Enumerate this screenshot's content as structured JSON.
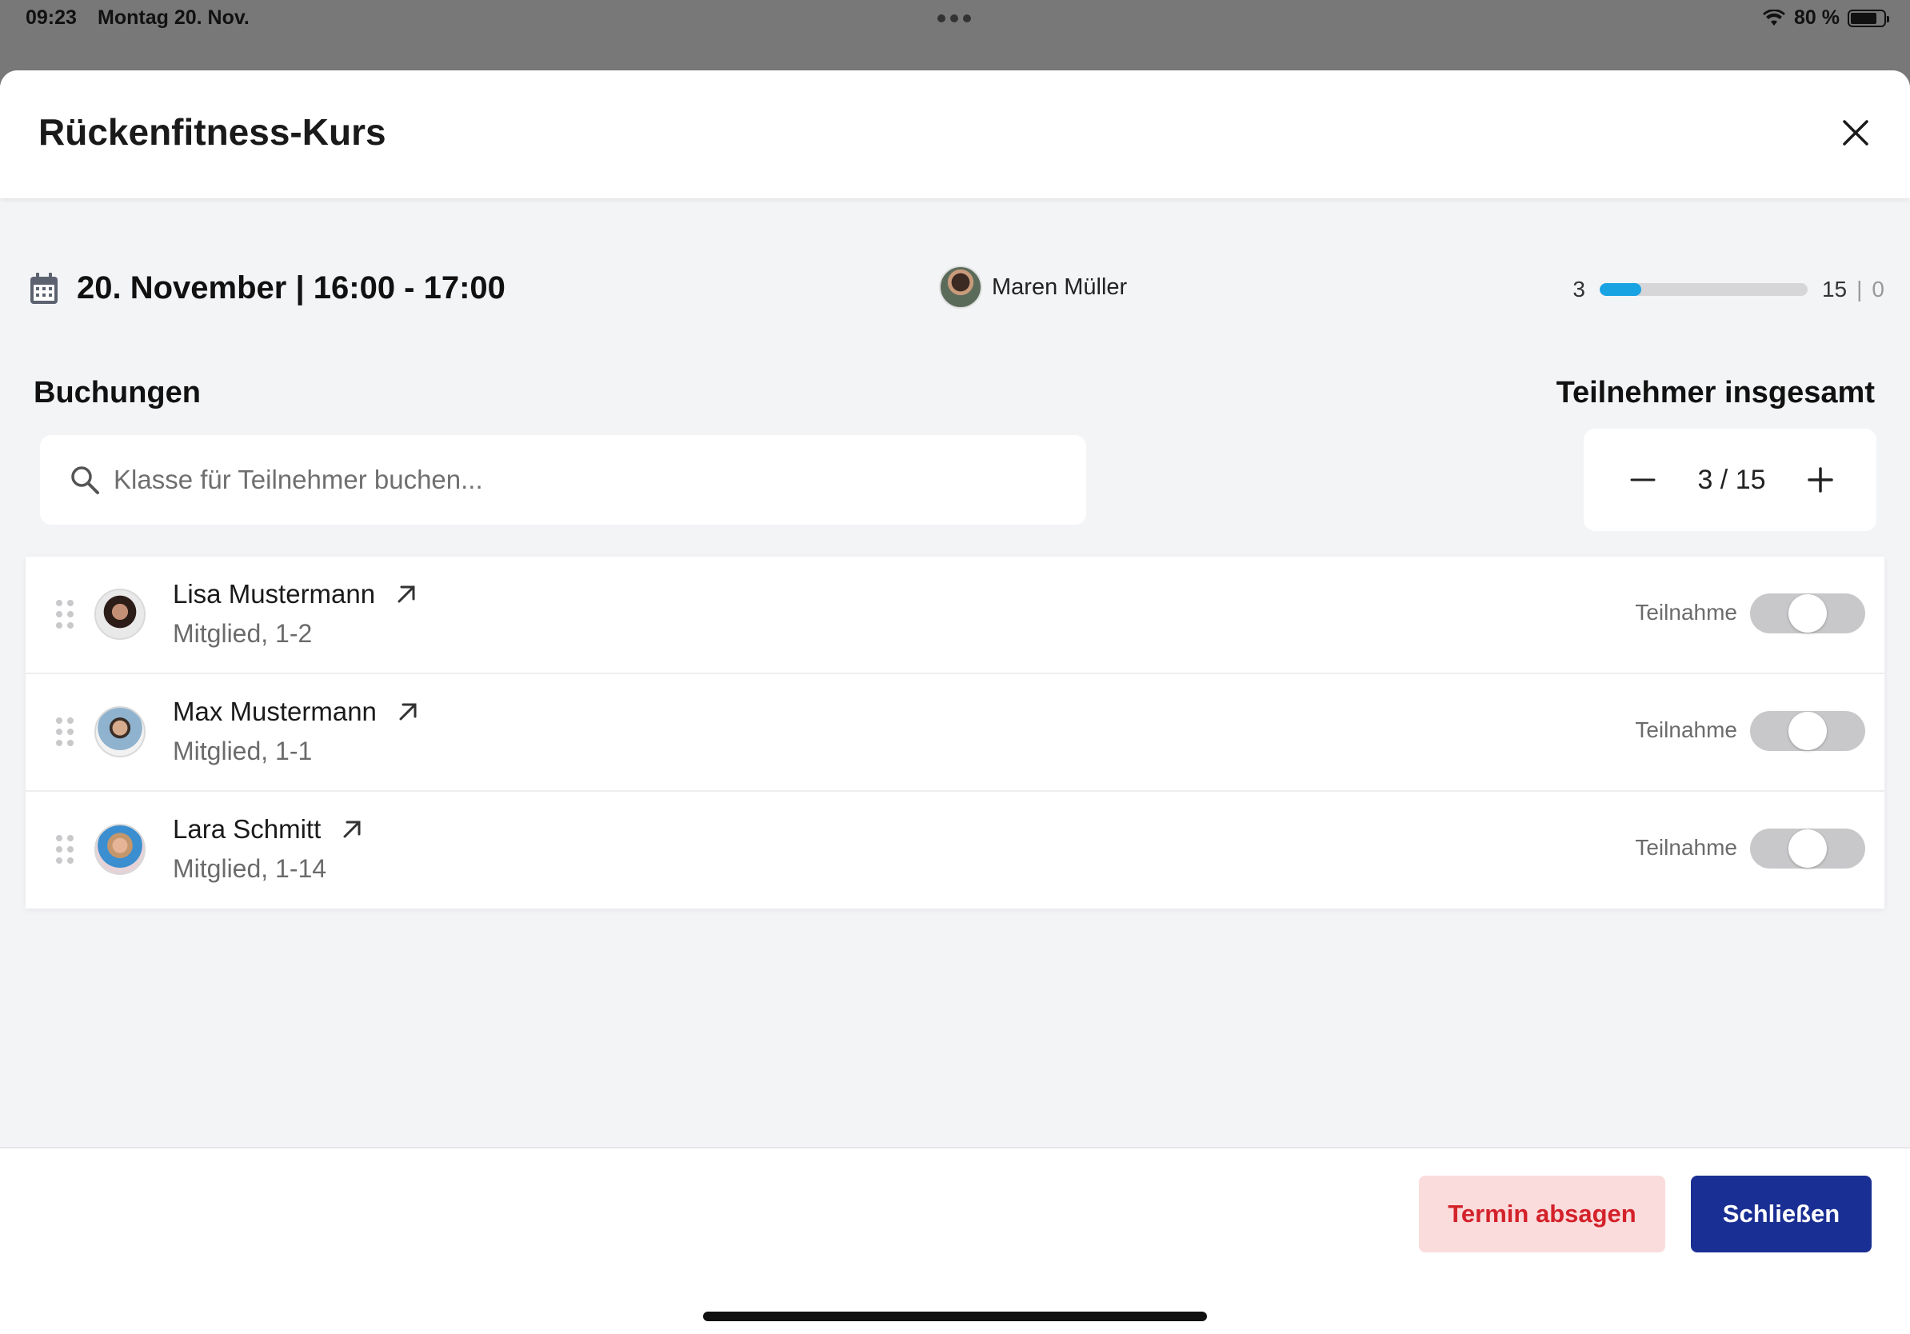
{
  "status_bar": {
    "time": "09:23",
    "date": "Montag 20. Nov.",
    "battery": "80 %",
    "battery_level": 0.8
  },
  "modal": {
    "title": "Rückenfitness-Kurs",
    "close_icon": "close-icon"
  },
  "event": {
    "date_time": "20. November | 16:00 - 17:00",
    "calendar_icon": "calendar-icon",
    "trainer_name": "Maren Müller",
    "capacity": {
      "booked": "3",
      "max": "15",
      "separator": "|",
      "waitlist": "0",
      "fill_fraction": 0.2,
      "bar_color": "#1aa3e3"
    }
  },
  "bookings": {
    "heading": "Buchungen",
    "search_placeholder": "Klasse für Teilnehmer buchen...",
    "search_value": ""
  },
  "participants_total": {
    "heading": "Teilnehmer insgesamt",
    "value": "3 / 15",
    "minus_icon": "minus-icon",
    "plus_icon": "plus-icon"
  },
  "participants": [
    {
      "name": "Lisa Mustermann",
      "meta": "Mitglied, 1-2",
      "toggle_label": "Teilnahme",
      "attended": false
    },
    {
      "name": "Max Mustermann",
      "meta": "Mitglied, 1-1",
      "toggle_label": "Teilnahme",
      "attended": false
    },
    {
      "name": "Lara Schmitt",
      "meta": "Mitglied, 1-14",
      "toggle_label": "Teilnahme",
      "attended": false
    }
  ],
  "footer": {
    "cancel_label": "Termin absagen",
    "close_label": "Schließen",
    "cancel_color": "#d3222a",
    "primary_color": "#1a2f93"
  }
}
